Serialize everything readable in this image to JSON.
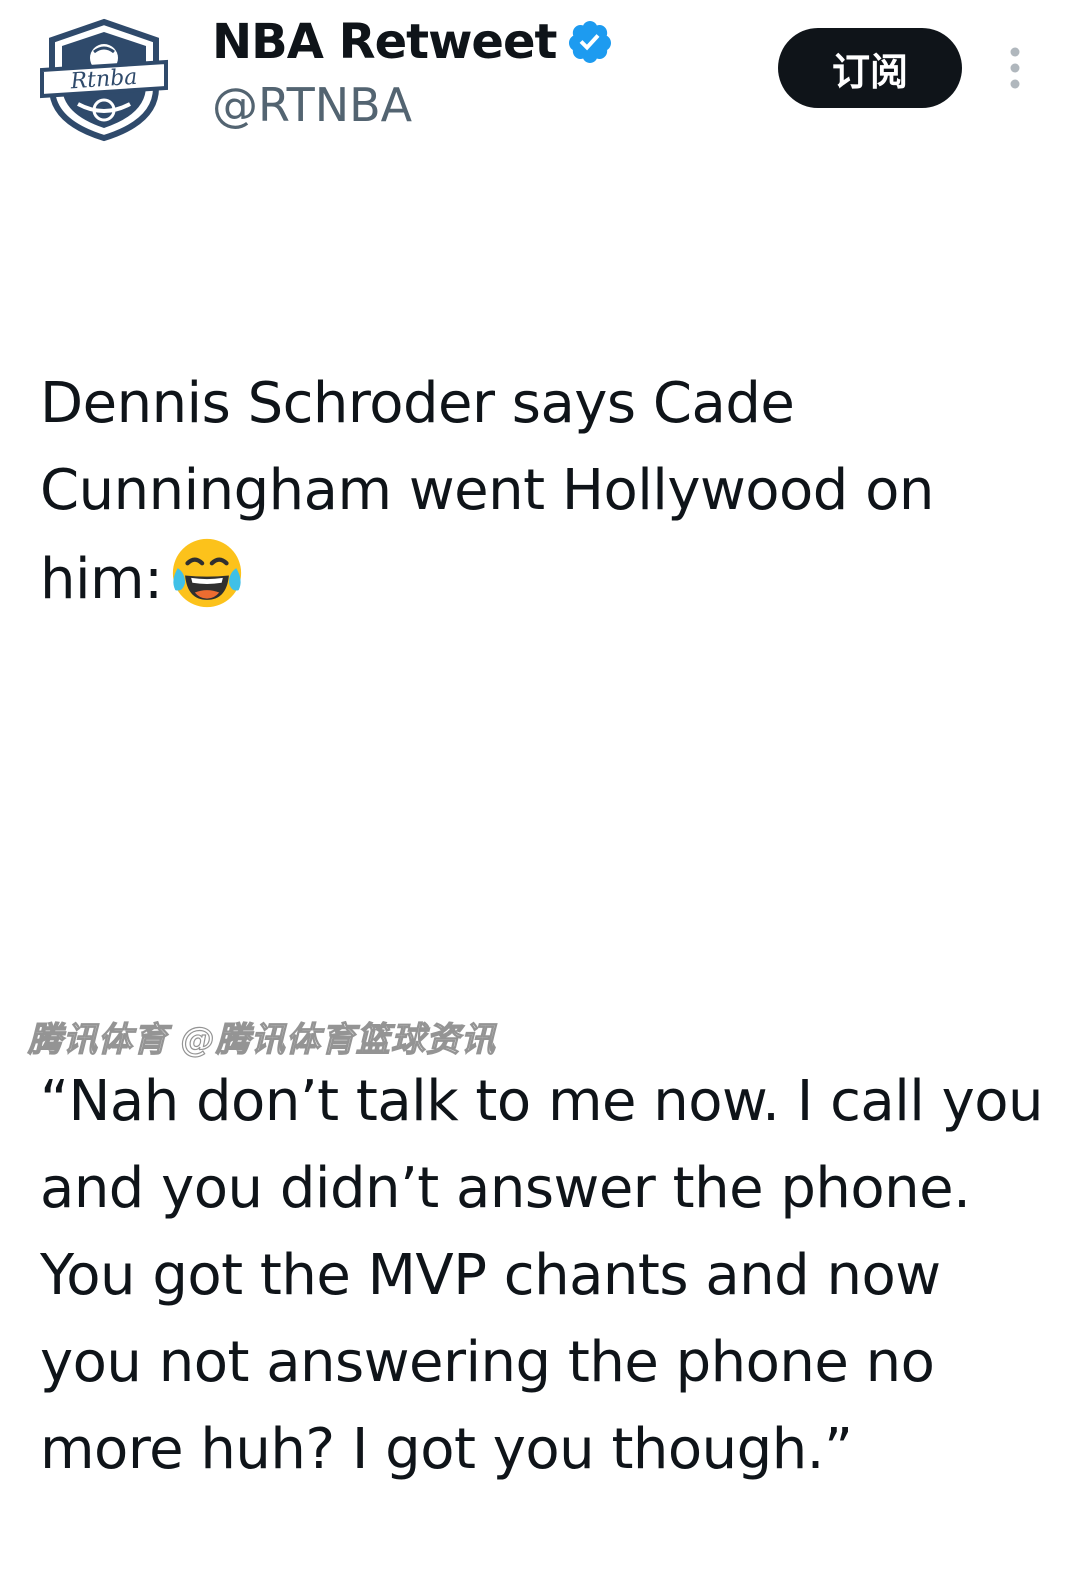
{
  "header": {
    "display_name": "NBA Retweet",
    "handle": "@RTNBA",
    "subscribe_label": "订阅",
    "avatar_text": "Rtnba",
    "verified_icon": "verified-badge-icon",
    "more_icon": "more-vertical-icon"
  },
  "tweet": {
    "paragraph_1": "Dennis Schroder says Cade Cunningham went Hollywood on him:",
    "emoji": "face-with-tears-of-joy-icon",
    "paragraph_2": "“Nah don’t talk to me now. I call you and you didn’t answer the phone. You got the MVP chants and now you not answering the phone no more huh? I got you though.”"
  },
  "watermark": {
    "text": "腾讯体育 @腾讯体育篮球资讯"
  },
  "colors": {
    "text": "#0f1419",
    "secondary": "#536471",
    "verified": "#1d9bf0",
    "button_bg": "#0f1419",
    "button_text": "#ffffff"
  }
}
